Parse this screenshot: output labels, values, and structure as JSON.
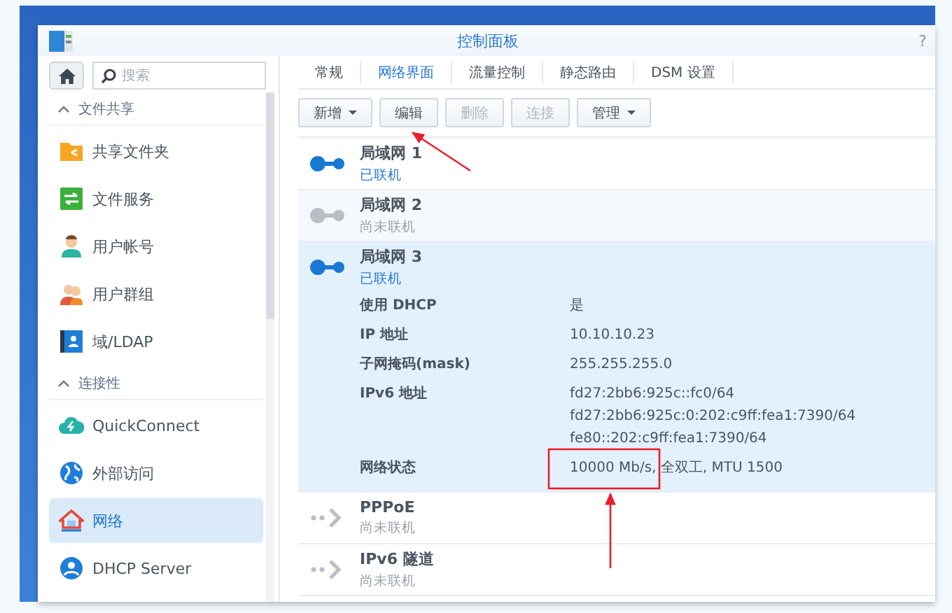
{
  "window": {
    "title": "控制面板",
    "help": "?"
  },
  "sidebar": {
    "search": {
      "placeholder": "搜索"
    },
    "items": [
      {
        "kind": "section",
        "label": "文件共享",
        "expanded": true
      },
      {
        "kind": "item",
        "label": "共享文件夹",
        "selected": false
      },
      {
        "kind": "item",
        "label": "文件服务",
        "selected": false
      },
      {
        "kind": "item",
        "label": "用户帐号",
        "selected": false
      },
      {
        "kind": "item",
        "label": "用户群组",
        "selected": false
      },
      {
        "kind": "item",
        "label": "域/LDAP",
        "selected": false
      },
      {
        "kind": "section",
        "label": "连接性",
        "expanded": true
      },
      {
        "kind": "item",
        "label": "QuickConnect",
        "selected": false
      },
      {
        "kind": "item",
        "label": "外部访问",
        "selected": false
      },
      {
        "kind": "item",
        "label": "网络",
        "selected": true
      },
      {
        "kind": "item",
        "label": "DHCP Server",
        "selected": false
      }
    ]
  },
  "tabs": [
    {
      "label": "常规",
      "selected": false
    },
    {
      "label": "网络界面",
      "selected": true
    },
    {
      "label": "流量控制",
      "selected": false
    },
    {
      "label": "静态路由",
      "selected": false
    },
    {
      "label": "DSM 设置",
      "selected": false
    }
  ],
  "toolbar": [
    {
      "label": "新增",
      "dropdown": true,
      "disabled": false
    },
    {
      "label": "编辑",
      "dropdown": false,
      "disabled": false
    },
    {
      "label": "删除",
      "dropdown": false,
      "disabled": true
    },
    {
      "label": "连接",
      "dropdown": false,
      "disabled": true
    },
    {
      "label": "管理",
      "dropdown": true,
      "disabled": false
    }
  ],
  "interfaces": [
    {
      "kind": "lan",
      "name": "局域网 1",
      "status": "已联机",
      "connected": true,
      "selected": false
    },
    {
      "kind": "lan",
      "name": "局域网 2",
      "status": "尚未联机",
      "connected": false,
      "selected": false
    },
    {
      "kind": "lan",
      "name": "局域网 3",
      "status": "已联机",
      "connected": true,
      "selected": true,
      "details": [
        {
          "label": "使用 DHCP",
          "values": [
            "是"
          ]
        },
        {
          "label": "IP 地址",
          "values": [
            "10.10.10.23"
          ]
        },
        {
          "label": "子网掩码(mask)",
          "values": [
            "255.255.255.0"
          ]
        },
        {
          "label": "IPv6 地址",
          "values": [
            "fd27:2bb6:925c::fc0/64",
            "fd27:2bb6:925c:0:202:c9ff:fea1:7390/64",
            "fe80::202:c9ff:fea1:7390/64"
          ]
        },
        {
          "label": "网络状态",
          "values": [
            "10000 Mb/s, 全双工, MTU 1500"
          ]
        }
      ]
    },
    {
      "kind": "tunnel",
      "name": "PPPoE",
      "status": "尚未联机",
      "connected": false,
      "selected": false
    },
    {
      "kind": "tunnel",
      "name": "IPv6 隧道",
      "status": "尚未联机",
      "connected": false,
      "selected": false
    }
  ]
}
